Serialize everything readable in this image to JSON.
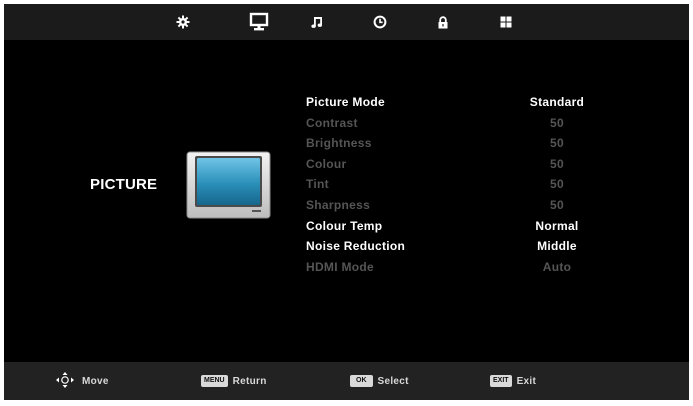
{
  "tabs": [
    {
      "icon": "gear-icon",
      "active": false
    },
    {
      "icon": "monitor-icon",
      "active": true
    },
    {
      "icon": "music-note-icon",
      "active": false
    },
    {
      "icon": "clock-icon",
      "active": false
    },
    {
      "icon": "lock-icon",
      "active": false
    },
    {
      "icon": "grid-icon",
      "active": false
    }
  ],
  "menu_title": "PICTURE",
  "settings": [
    {
      "label": "Picture Mode",
      "value": "Standard",
      "enabled": true
    },
    {
      "label": "Contrast",
      "value": "50",
      "enabled": false
    },
    {
      "label": "Brightness",
      "value": "50",
      "enabled": false
    },
    {
      "label": "Colour",
      "value": "50",
      "enabled": false
    },
    {
      "label": "Tint",
      "value": "50",
      "enabled": false
    },
    {
      "label": "Sharpness",
      "value": "50",
      "enabled": false
    },
    {
      "label": "Colour Temp",
      "value": "Normal",
      "enabled": true
    },
    {
      "label": "Noise Reduction",
      "value": "Middle",
      "enabled": true
    },
    {
      "label": "HDMI Mode",
      "value": "Auto",
      "enabled": false
    }
  ],
  "footer": {
    "move_label": "Move",
    "menu_key": "MENU",
    "return_label": "Return",
    "ok_key": "OK",
    "select_label": "Select",
    "exit_key": "EXIT",
    "exit_label": "Exit"
  },
  "colors": {
    "background": "#000000",
    "bar": "#1b1b1b",
    "enabled_text": "#ffffff",
    "disabled_text": "#555555",
    "tv_screen": "#2a8fb8"
  }
}
